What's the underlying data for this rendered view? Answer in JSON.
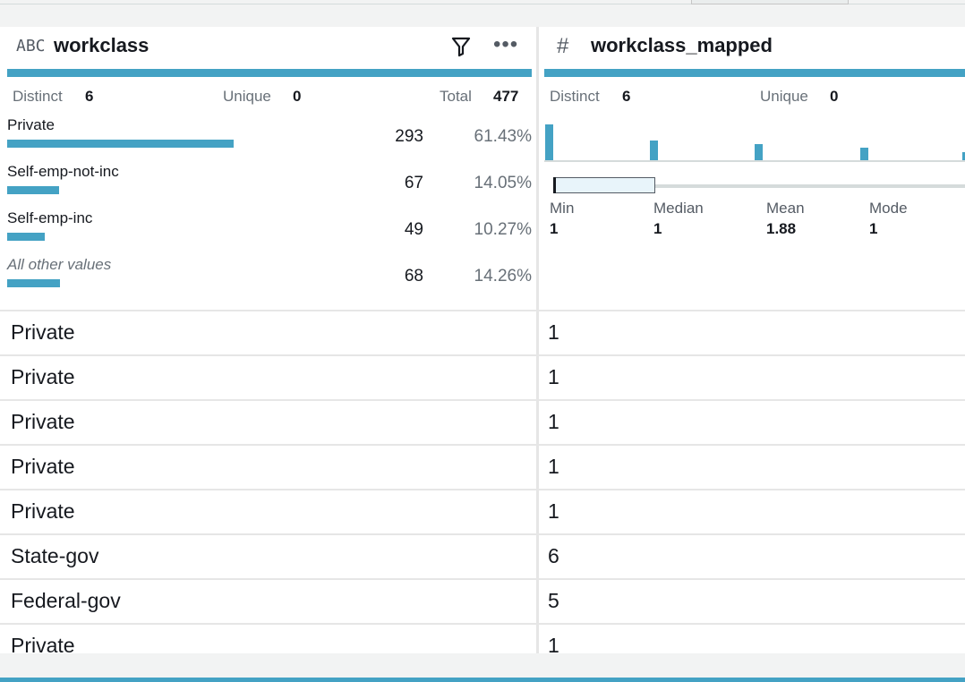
{
  "columns": [
    {
      "type_icon": "ABC",
      "name": "workclass",
      "stats": {
        "distinct_label": "Distinct",
        "distinct": "6",
        "unique_label": "Unique",
        "unique": "0",
        "total_label": "Total",
        "total": "477"
      },
      "categories": [
        {
          "label": "Private",
          "count": "293",
          "pct": "61.43%",
          "share": 0.6143
        },
        {
          "label": "Self-emp-not-inc",
          "count": "67",
          "pct": "14.05%",
          "share": 0.1405
        },
        {
          "label": "Self-emp-inc",
          "count": "49",
          "pct": "10.27%",
          "share": 0.1027
        },
        {
          "label": "All other values",
          "count": "68",
          "pct": "14.26%",
          "share": 0.1426
        }
      ]
    },
    {
      "type_icon": "#",
      "name": "workclass_mapped",
      "stats": {
        "distinct_label": "Distinct",
        "distinct": "6",
        "unique_label": "Unique",
        "unique": "0"
      },
      "summary": [
        {
          "label": "Min",
          "value": "1"
        },
        {
          "label": "Median",
          "value": "1"
        },
        {
          "label": "Mean",
          "value": "1.88"
        },
        {
          "label": "Mode",
          "value": "1"
        }
      ]
    }
  ],
  "rows": [
    [
      "Private",
      "1"
    ],
    [
      "Private",
      "1"
    ],
    [
      "Private",
      "1"
    ],
    [
      "Private",
      "1"
    ],
    [
      "Private",
      "1"
    ],
    [
      "State-gov",
      "6"
    ],
    [
      "Federal-gov",
      "5"
    ],
    [
      "Private",
      "1"
    ]
  ],
  "colors": {
    "accent": "#44a2c4",
    "divider": "#e6e6e6"
  },
  "icons": {
    "filter": "filter-icon",
    "more": "more-options-icon"
  }
}
